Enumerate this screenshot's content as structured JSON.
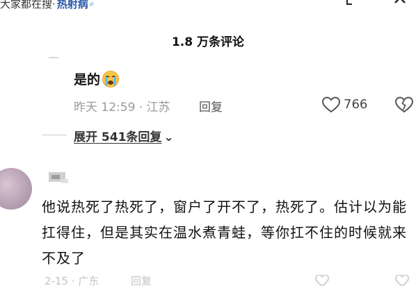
{
  "header": {
    "search_hint": "大家都在搜·",
    "hot_topic": "热射病",
    "search_icon": "search-icon",
    "expand_icon": "expand-icon",
    "close_icon": "close-icon"
  },
  "comment_count": "1.8 万条评论",
  "reply": {
    "text": "是的",
    "emoji": "crying-face-icon",
    "time_location": "昨天 12:59 · 江苏",
    "reply_label": "回复",
    "likes": "766"
  },
  "expand_replies": "展开 541条回复",
  "comment": {
    "text": "他说热死了热死了，窗户了开不了，热死了。估计以为能扛得住，但是其实在温水煮青蛙，等你扛不住的时候就来不及了",
    "bottom_meta": "2-15 · 广东",
    "bottom_reply": "回复"
  },
  "colors": {
    "link_blue": "#2a5aa8",
    "meta_gray": "#9a9a9a",
    "text_dark": "#111111"
  }
}
